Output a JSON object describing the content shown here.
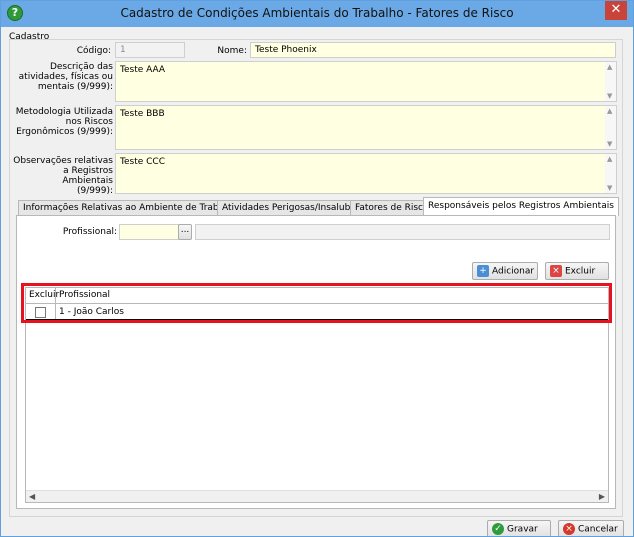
{
  "window": {
    "title": "Cadastro de Condições Ambientais do Trabalho - Fatores de Risco",
    "close": "✕"
  },
  "cadastro": {
    "group_label": "Cadastro",
    "codigo_label": "Código:",
    "codigo_value": "1",
    "nome_label": "Nome:",
    "nome_value": "Teste Phoenix",
    "descricao_label": [
      "Descrição das",
      "atividades, físicas ou",
      "mentais (9/999):"
    ],
    "descricao_value": "Teste AAA",
    "metodologia_label": [
      "Metodologia Utilizada",
      "nos Riscos",
      "Ergonômicos (9/999):"
    ],
    "metodologia_value": "Teste BBB",
    "observacoes_label": [
      "Observações relativas",
      "a Registros Ambientais",
      "(9/999):"
    ],
    "observacoes_value": "Teste CCC"
  },
  "tabs": [
    {
      "label": "Informações Relativas ao Ambiente de Trabalho"
    },
    {
      "label": "Atividades Perigosas/Insalubres"
    },
    {
      "label": "Fatores de Risco"
    },
    {
      "label": "Responsáveis pelos Registros Ambientais"
    }
  ],
  "responsaveis": {
    "profissional_label": "Profissional:",
    "lookup_button": "...",
    "adicionar_label": "Adicionar",
    "excluir_label": "Excluir",
    "grid": {
      "columns": [
        "Excluir",
        "Profissional"
      ],
      "rows": [
        {
          "excluir": false,
          "profissional": "1 - João Carlos"
        }
      ]
    }
  },
  "footer": {
    "gravar_label": "Gravar",
    "cancelar_label": "Cancelar"
  },
  "colors": {
    "title_bar": "#6aa9e6",
    "field_yellow": "#ffffe1",
    "highlight": "#e8121e",
    "close": "#c8443a"
  }
}
